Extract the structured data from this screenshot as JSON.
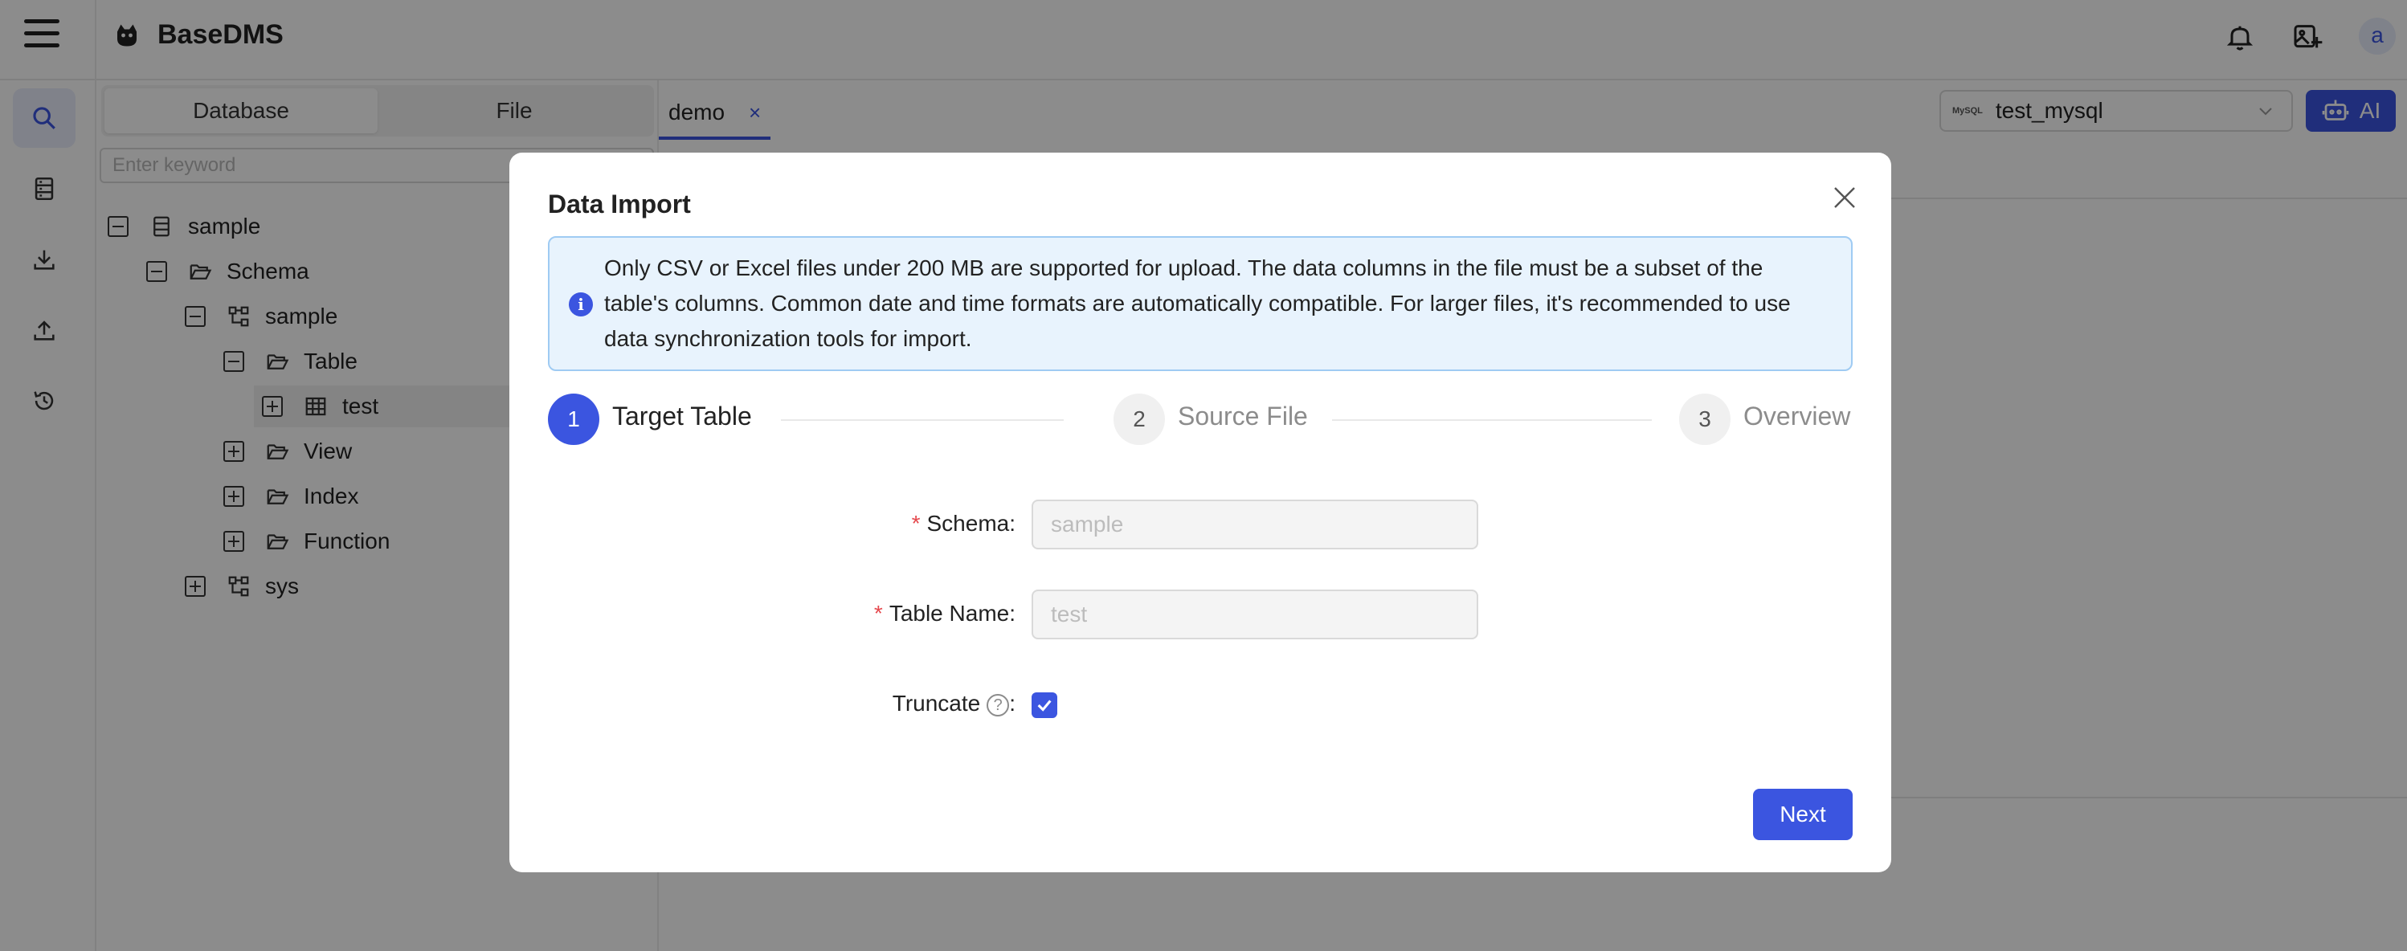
{
  "header": {
    "app_title": "BaseDMS",
    "avatar_letter": "a"
  },
  "sidebar": {
    "tabs": [
      "Database",
      "File"
    ],
    "search_placeholder": "Enter keyword",
    "tree": [
      {
        "label": "sample",
        "toggle": "minus",
        "icon": "database-icon",
        "level": 0
      },
      {
        "label": "Schema",
        "toggle": "minus",
        "icon": "folder-open-icon",
        "level": 1
      },
      {
        "label": "sample",
        "toggle": "minus",
        "icon": "schema-icon",
        "level": 2
      },
      {
        "label": "Table",
        "toggle": "minus",
        "icon": "folder-open-icon",
        "level": 3
      },
      {
        "label": "test",
        "toggle": "plus",
        "icon": "table-icon",
        "level": 4,
        "selected": true
      },
      {
        "label": "View",
        "toggle": "plus",
        "icon": "folder-open-icon",
        "level": 3
      },
      {
        "label": "Index",
        "toggle": "plus",
        "icon": "folder-open-icon",
        "level": 3
      },
      {
        "label": "Function",
        "toggle": "plus",
        "icon": "folder-open-icon",
        "level": 3
      },
      {
        "label": "sys",
        "toggle": "plus",
        "icon": "schema-icon",
        "level": 2
      }
    ]
  },
  "main": {
    "tab_label": "demo",
    "tab_close": "×",
    "connection_badge": "MySQL",
    "connection_name": "test_mysql",
    "ai_label": "AI"
  },
  "modal": {
    "title": "Data Import",
    "alert_text": "Only CSV or Excel files under 200 MB are supported for upload. The data columns in the file must be a subset of the table's columns. Common date and time formats are automatically compatible. For larger files, it's recommended to use data synchronization tools for import.",
    "steps": [
      {
        "number": "1",
        "label": "Target Table",
        "status": "active"
      },
      {
        "number": "2",
        "label": "Source File",
        "status": "inactive"
      },
      {
        "number": "3",
        "label": "Overview",
        "status": "inactive"
      }
    ],
    "form": {
      "schema_label": "Schema",
      "schema_value": "sample",
      "table_label": "Table Name",
      "table_value": "test",
      "truncate_label": "Truncate",
      "truncate_checked": true,
      "required_mark": "*",
      "colon": ":",
      "help_mark": "?"
    },
    "next_label": "Next"
  },
  "colors": {
    "accent": "#3b55e0",
    "alert_bg": "#e8f3fd",
    "alert_border": "#9fcbf3",
    "required": "#e5484d"
  }
}
